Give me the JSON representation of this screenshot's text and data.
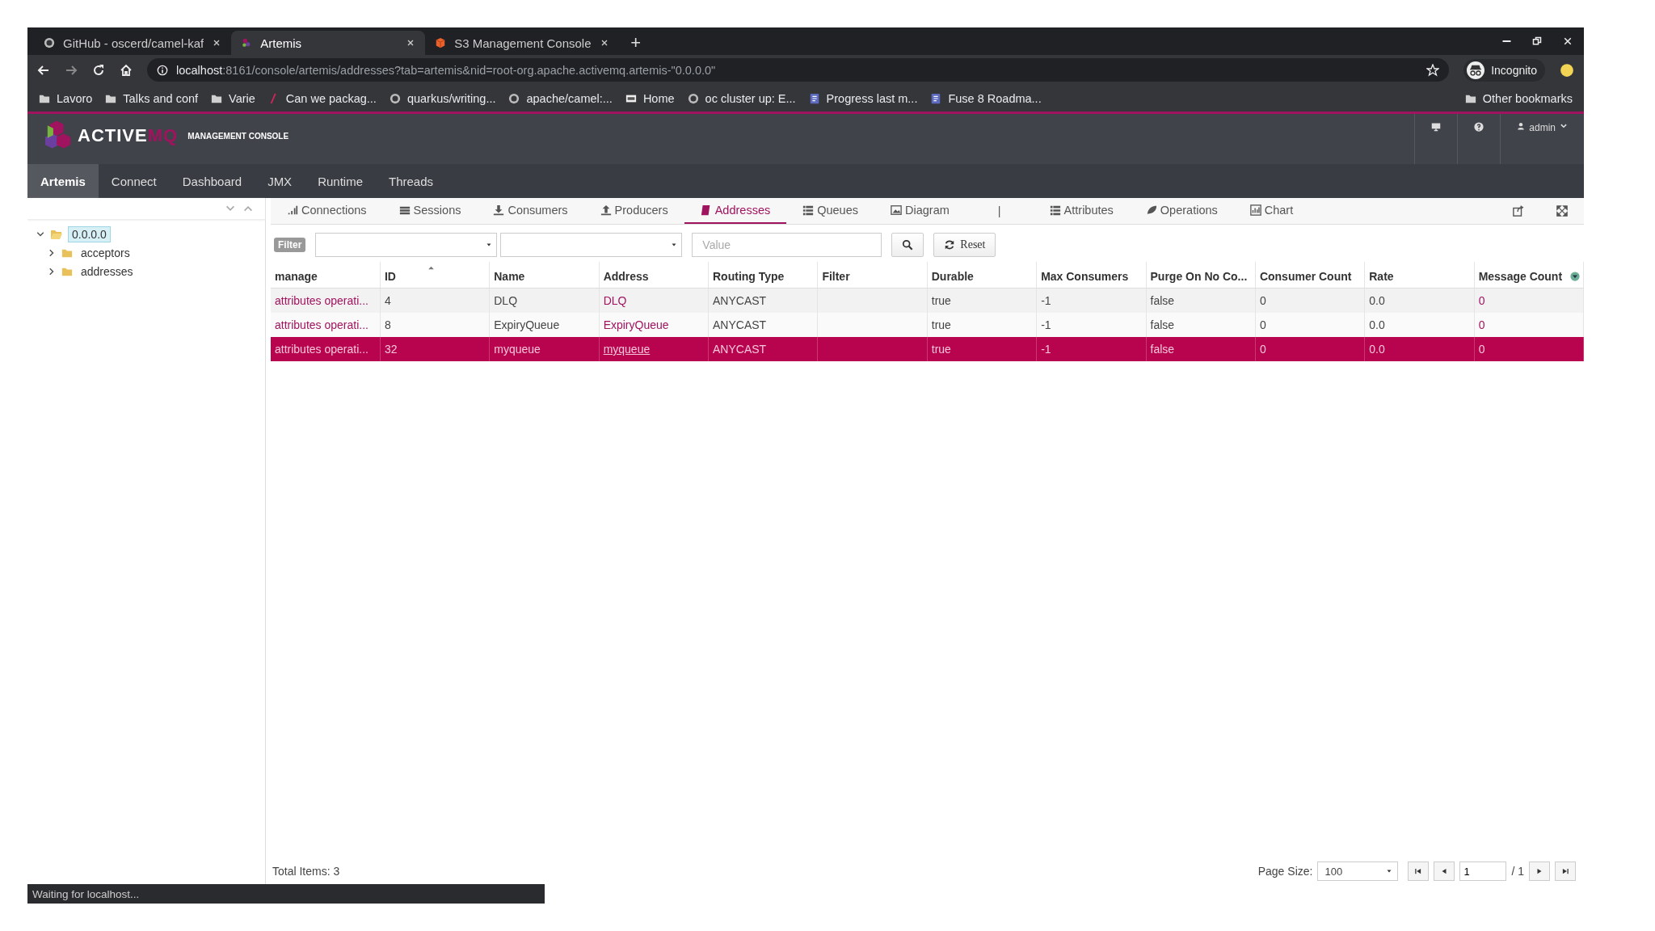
{
  "browser": {
    "tabs": [
      {
        "title": "GitHub - oscerd/camel-kaf",
        "selected": false
      },
      {
        "title": "Artemis",
        "selected": true
      },
      {
        "title": "S3 Management Console",
        "selected": false
      }
    ],
    "new_tab": "+",
    "address_bar": {
      "host": "localhost",
      "rest": ":8161/console/artemis/addresses?tab=artemis&nid=root-org.apache.activemq.artemis-\"0.0.0.0\""
    },
    "profile": "Incognito",
    "bookmarks": [
      {
        "label": "Lavoro",
        "kind": "folder"
      },
      {
        "label": "Talks and conf",
        "kind": "folder"
      },
      {
        "label": "Varie",
        "kind": "folder"
      },
      {
        "label": "Can we packag...",
        "kind": "link"
      },
      {
        "label": "quarkus/writing...",
        "kind": "link"
      },
      {
        "label": "apache/camel:...",
        "kind": "link"
      },
      {
        "label": "Home",
        "kind": "link"
      },
      {
        "label": "oc cluster up: E...",
        "kind": "link"
      },
      {
        "label": "Progress last m...",
        "kind": "link"
      },
      {
        "label": "Fuse 8 Roadma...",
        "kind": "link"
      }
    ],
    "other_bookmarks": "Other bookmarks",
    "status": "Waiting for localhost..."
  },
  "app": {
    "brand": {
      "name": "ACTIVE",
      "name_accent": "MQ",
      "subtitle": "MANAGEMENT CONSOLE"
    },
    "user": "admin",
    "nav": [
      {
        "label": "Artemis",
        "selected": true
      },
      {
        "label": "Connect",
        "selected": false
      },
      {
        "label": "Dashboard",
        "selected": false
      },
      {
        "label": "JMX",
        "selected": false
      },
      {
        "label": "Runtime",
        "selected": false
      },
      {
        "label": "Threads",
        "selected": false
      }
    ],
    "tree": [
      {
        "label": "0.0.0.0",
        "expanded": true,
        "selected": true,
        "children": [
          {
            "label": "acceptors",
            "expanded": false,
            "selected": false
          },
          {
            "label": "addresses",
            "expanded": false,
            "selected": false
          }
        ]
      }
    ],
    "subtabs": [
      {
        "label": "Connections",
        "kind": "tab",
        "selected": false
      },
      {
        "label": "Sessions",
        "kind": "tab",
        "selected": false
      },
      {
        "label": "Consumers",
        "kind": "tab",
        "selected": false
      },
      {
        "label": "Producers",
        "kind": "tab",
        "selected": false
      },
      {
        "label": "Addresses",
        "kind": "tab",
        "selected": true
      },
      {
        "label": "Queues",
        "kind": "tab",
        "selected": false
      },
      {
        "label": "Diagram",
        "kind": "tab",
        "selected": false
      },
      {
        "label": "|",
        "kind": "separator"
      },
      {
        "label": "Attributes",
        "kind": "tab",
        "selected": false
      },
      {
        "label": "Operations",
        "kind": "tab",
        "selected": false
      },
      {
        "label": "Chart",
        "kind": "tab",
        "selected": false
      }
    ],
    "filter": {
      "label": "Filter",
      "value_placeholder": "Value",
      "reset": "Reset"
    },
    "table": {
      "columns": [
        {
          "label": "manage",
          "kind": "link",
          "sorted": false
        },
        {
          "label": "ID",
          "kind": "text",
          "sorted": true
        },
        {
          "label": "Name",
          "kind": "text",
          "sorted": false
        },
        {
          "label": "Address",
          "kind": "link",
          "sorted": false
        },
        {
          "label": "Routing Type",
          "kind": "text",
          "sorted": false
        },
        {
          "label": "Filter",
          "kind": "text",
          "sorted": false
        },
        {
          "label": "Durable",
          "kind": "text",
          "sorted": false
        },
        {
          "label": "Max Consumers",
          "kind": "text",
          "sorted": false
        },
        {
          "label": "Purge On No Co...",
          "kind": "text",
          "sorted": false
        },
        {
          "label": "Consumer Count",
          "kind": "text",
          "sorted": false
        },
        {
          "label": "Rate",
          "kind": "text",
          "sorted": false
        },
        {
          "label": "Message Count",
          "kind": "count",
          "sorted": false
        }
      ],
      "rows": [
        {
          "selected": false,
          "cells": [
            "attributes operati...",
            "4",
            "DLQ",
            "DLQ",
            "ANYCAST",
            "",
            "true",
            "-1",
            "false",
            "0",
            "0.0",
            "0"
          ]
        },
        {
          "selected": false,
          "cells": [
            "attributes operati...",
            "8",
            "ExpiryQueue",
            "ExpiryQueue",
            "ANYCAST",
            "",
            "true",
            "-1",
            "false",
            "0",
            "0.0",
            "0"
          ]
        },
        {
          "selected": true,
          "cells": [
            "attributes operati...",
            "32",
            "myqueue",
            "myqueue",
            "ANYCAST",
            "",
            "true",
            "-1",
            "false",
            "0",
            "0.0",
            "0"
          ]
        }
      ]
    },
    "total_items": "Total Items: 3",
    "pagination": {
      "page_size_label": "Page Size:",
      "page_size": "100",
      "page": "1",
      "total_pages": "/ 1"
    }
  }
}
